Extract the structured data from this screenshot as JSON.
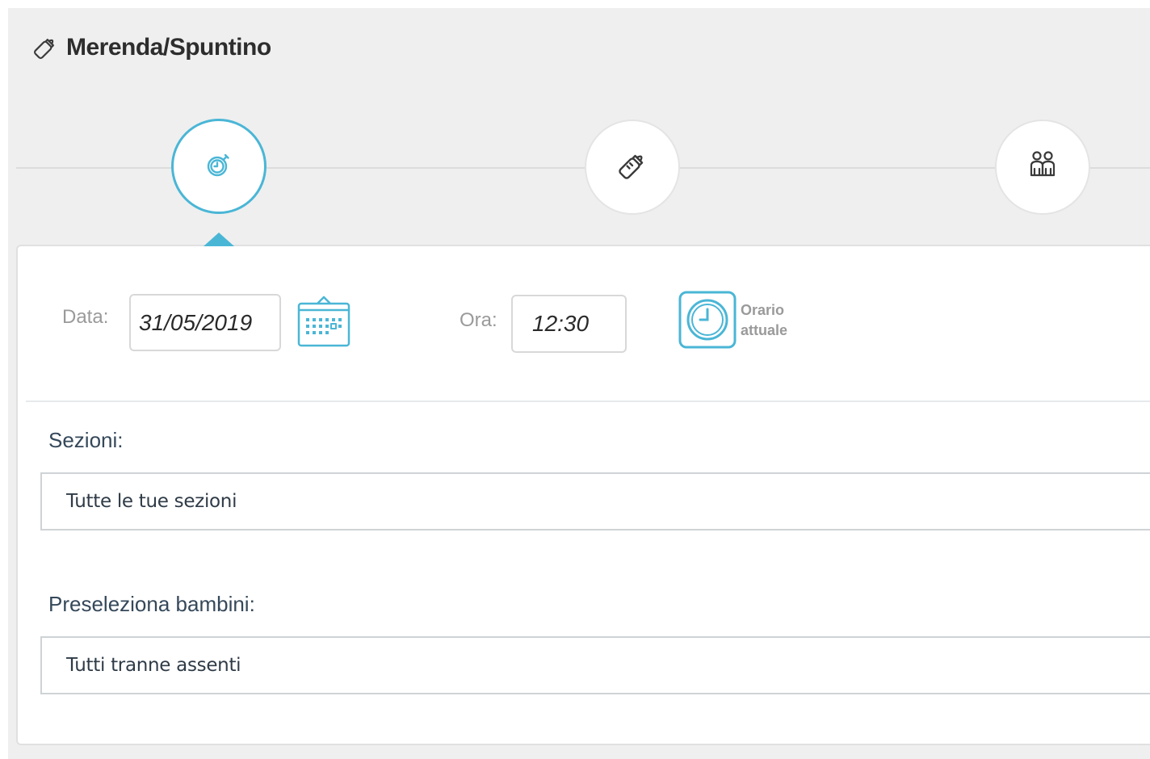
{
  "header": {
    "title": "Merenda/Spuntino",
    "icon": "baby-bottle-icon"
  },
  "stepper": {
    "steps": [
      {
        "icon": "stopwatch-icon",
        "active": true
      },
      {
        "icon": "baby-bottle-icon",
        "active": false
      },
      {
        "icon": "children-icon",
        "active": false
      }
    ]
  },
  "form": {
    "date_label": "Data:",
    "date_value": "31/05/2019",
    "time_label": "Ora:",
    "time_value": "12:30",
    "now_label_line1": "Orario",
    "now_label_line2": "attuale",
    "sections_label": "Sezioni:",
    "sections_value": "Tutte le tue sezioni",
    "preselect_label": "Preseleziona bambini:",
    "preselect_value": "Tutti tranne assenti"
  },
  "colors": {
    "accent": "#4ab6d6",
    "background": "#efefef",
    "label": "#35485a"
  }
}
